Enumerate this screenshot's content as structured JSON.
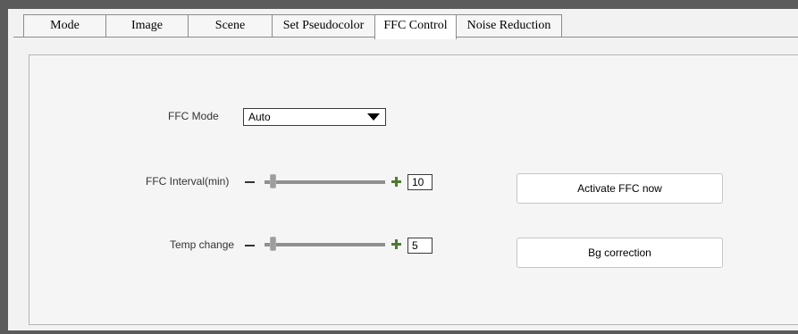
{
  "tabs": [
    {
      "label": "Mode",
      "active": false
    },
    {
      "label": "Image",
      "active": false
    },
    {
      "label": "Scene",
      "active": false
    },
    {
      "label": "Set Pseudocolor",
      "active": false
    },
    {
      "label": "FFC Control",
      "active": true
    },
    {
      "label": "Noise Reduction",
      "active": false
    }
  ],
  "ffc": {
    "mode_label": "FFC Mode",
    "mode_value": "Auto",
    "interval_label": "FFC Interval(min)",
    "interval_value": "10",
    "interval_slider_level": 0.05,
    "temp_label": "Temp change",
    "temp_value": "5",
    "temp_slider_level": 0.05
  },
  "buttons": {
    "activate_label": "Activate FFC now",
    "bg_correction_label": "Bg correction"
  },
  "icons": {
    "minus": "minus-icon",
    "plus": "plus-icon",
    "dropdown": "chevron-down-icon"
  },
  "colors": {
    "plus_accent": "#4d7a33",
    "frame": "#5b5b5b"
  }
}
